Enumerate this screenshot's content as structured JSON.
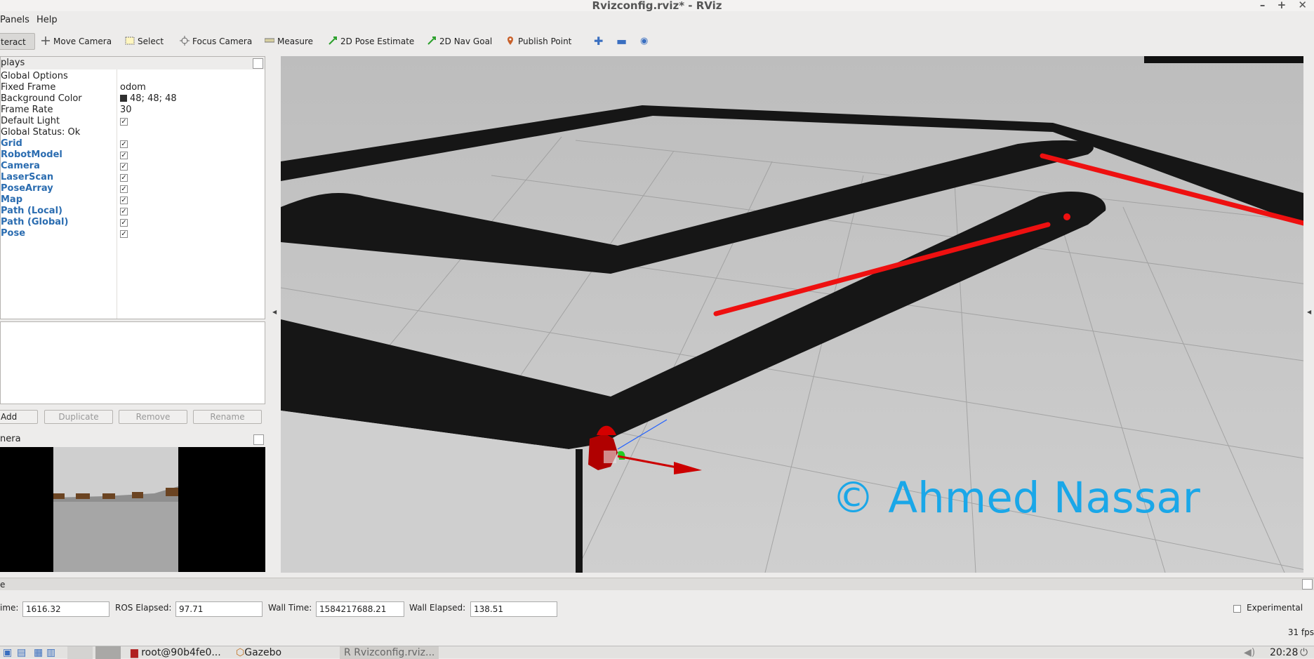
{
  "window": {
    "title": "Rvizconfig.rviz* - RViz",
    "controls": "– + ✕"
  },
  "menu": {
    "panels": "Panels",
    "help": "Help"
  },
  "toolbar": {
    "interact": "teract",
    "move_camera": "Move Camera",
    "select": "Select",
    "focus_camera": "Focus Camera",
    "measure": "Measure",
    "pose_estimate": "2D Pose Estimate",
    "nav_goal": "2D Nav Goal",
    "publish_point": "Publish Point"
  },
  "displays": {
    "header": "plays",
    "global_options": "Global Options",
    "options": [
      {
        "label": "Fixed Frame",
        "value": "odom"
      },
      {
        "label": "Background Color",
        "value": "48; 48; 48"
      },
      {
        "label": "Frame Rate",
        "value": "30"
      },
      {
        "label": "Default Light",
        "value": "✓"
      }
    ],
    "global_status": "Global Status: Ok",
    "items": [
      "Grid",
      "RobotModel",
      "Camera",
      "LaserScan",
      "PoseArray",
      "Map",
      "Path (Local)",
      "Path (Global)",
      "Pose"
    ],
    "check": "✓"
  },
  "buttons": {
    "add": "Add",
    "duplicate": "Duplicate",
    "remove": "Remove",
    "rename": "Rename"
  },
  "camera_panel": {
    "header": "nera"
  },
  "viewport": {
    "watermark": "© Ahmed Nassar"
  },
  "time": {
    "header": "e",
    "ros_time_label": "ime:",
    "ros_time": "1616.32",
    "ros_elapsed_label": "ROS Elapsed:",
    "ros_elapsed": "97.71",
    "wall_time_label": "Wall Time:",
    "wall_time": "1584217688.21",
    "wall_elapsed_label": "Wall Elapsed:",
    "wall_elapsed": "138.51",
    "experimental": "Experimental",
    "fps": "31 fps"
  },
  "taskbar": {
    "terminal": "root@90b4fe0...",
    "gazebo": "Gazebo",
    "rviz": "Rvizconfig.rviz...",
    "clock": "20:28"
  },
  "colors": {
    "robot": "#c00000",
    "laser": "#ff1010",
    "watermark": "#1aa7e8",
    "display_blue": "#2a6cb0"
  }
}
